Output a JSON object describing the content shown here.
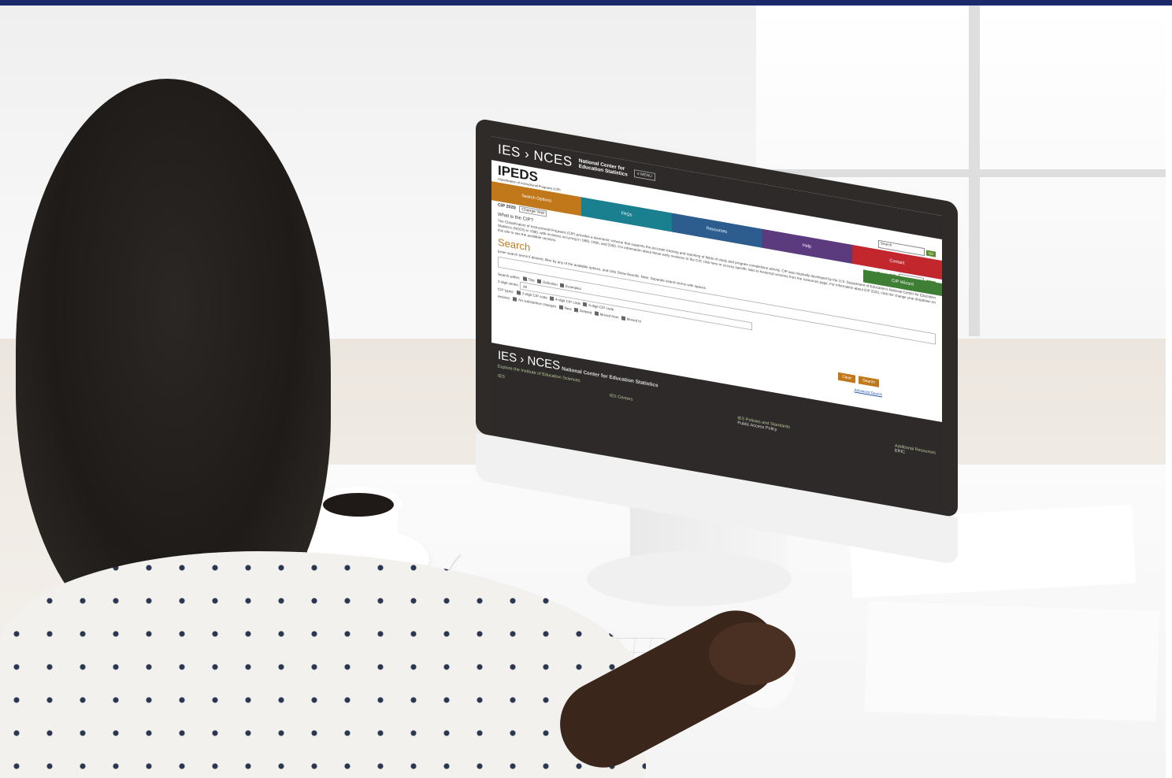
{
  "ies_header": {
    "logo": "IES › NCES",
    "subtitle_line1": "National Center for",
    "subtitle_line2": "Education Statistics",
    "menu": "≡ MENU"
  },
  "ipeds": {
    "logo": "IPEDS",
    "subtitle": "Classification of Instructional Programs (CIP)",
    "search_placeholder": "Search",
    "go": "Go"
  },
  "nav": {
    "search_options": "Search Options",
    "faqs": "FAQs",
    "resources": "Resources",
    "help": "Help",
    "contact": "Contact",
    "wizard": "CIP Wizard"
  },
  "cip": {
    "label": "CIP 2020",
    "change_year": "Change Year",
    "quick_label": "Quick CIP",
    "go": "Go"
  },
  "about": {
    "heading": "What is the CIP?",
    "body": "The Classification of Instructional Programs (CIP) provides a taxonomic scheme that supports the accurate tracking and reporting of fields of study and program completions activity. CIP was originally developed by the U.S. Department of Education's National Center for Education Statistics (NCES) in 1980, with revisions occurring in 1985, 1990, and 2000. For information about these early revisions to the CIP, click here or access specific links to historical versions from the resources page. For information about CIP 2020, click the change year dropdown on this site to see the available versions."
  },
  "search": {
    "title": "Search",
    "hint": "Enter search terms if desired, filter by any of the available options, and click Show Results. Note: Separate search terms with spaces.",
    "within_label": "Search within:",
    "within_opts": [
      "Title",
      "Definition",
      "Examples"
    ],
    "series_label": "2-digit series:",
    "series_value": "All",
    "types_label": "CIP types:",
    "types_opts": [
      "2-digit CIP code",
      "4-digit CIP code",
      "6-digit CIP code"
    ],
    "actions_label": "Actions:",
    "actions_opts": [
      "No substantive changes",
      "New",
      "Deleted",
      "Moved from",
      "Moved to"
    ],
    "clear": "Clear",
    "search_btn": "Search",
    "advanced": "Advanced Search"
  },
  "footer": {
    "logo": "IES › NCES",
    "sub1": "National Center for",
    "sub2": "Education Statistics",
    "explore": "Explore the Institute of Education Sciences",
    "ies": "IES",
    "centers": "IES Centers",
    "policies": "IES Policies and Standards",
    "public_access": "Public Access Policy",
    "additional": "Additional Resources",
    "eric": "ERIC"
  }
}
